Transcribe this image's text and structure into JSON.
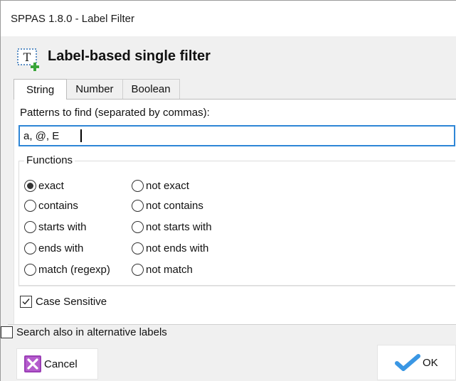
{
  "window": {
    "title": "SPPAS 1.8.0  - Label Filter"
  },
  "header": {
    "title": "Label-based single filter",
    "icon": "text-tier-add-icon",
    "icon_glyph": "T"
  },
  "tabs": [
    {
      "label": "String",
      "active": true
    },
    {
      "label": "Number",
      "active": false
    },
    {
      "label": "Boolean",
      "active": false
    }
  ],
  "pattern": {
    "label": "Patterns to find (separated by commas):",
    "value": "a, @, E"
  },
  "functions": {
    "title": "Functions",
    "selected": "exact",
    "options": [
      [
        "exact",
        "not exact"
      ],
      [
        "contains",
        "not contains"
      ],
      [
        "starts with",
        "not starts with"
      ],
      [
        "ends with",
        "not ends with"
      ],
      [
        "match (regexp)",
        "not match"
      ]
    ]
  },
  "case_sensitive": {
    "label": "Case Sensitive",
    "checked": true
  },
  "alternative_labels": {
    "label": "Search also in alternative labels",
    "checked": false
  },
  "buttons": {
    "cancel": {
      "label": "Cancel",
      "icon": "cancel-x-icon",
      "color": "#9b3fb6"
    },
    "ok": {
      "label": "OK",
      "icon": "checkmark-icon",
      "color": "#3a97e4"
    }
  },
  "colors": {
    "accent": "#2e86d6"
  }
}
